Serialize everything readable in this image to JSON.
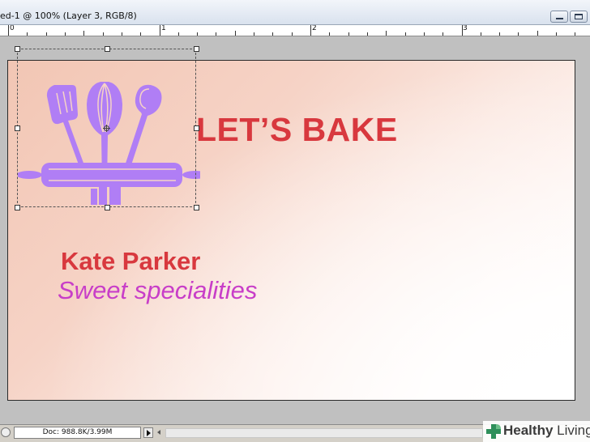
{
  "window": {
    "title": "ed-1 @ 100% (Layer 3, RGB/8)"
  },
  "ruler": {
    "labels": [
      "0",
      "1",
      "2",
      "3"
    ]
  },
  "document": {
    "headline": "LET’S BAKE",
    "name": "Kate Parker",
    "tagline": "Sweet specialities",
    "colors": {
      "headline": "#d8383e",
      "tagline": "#c83ec8",
      "logo": "#b07ef5",
      "background_start": "#f2c6b4",
      "background_end": "#ffffff"
    },
    "logo_icon": "baking-utensils-icon"
  },
  "status": {
    "doc_info": "Doc: 988.8K/3.99M"
  },
  "watermark": {
    "bold": "Healthy",
    "regular": " Living",
    "icon": "plus-leaf-icon"
  }
}
